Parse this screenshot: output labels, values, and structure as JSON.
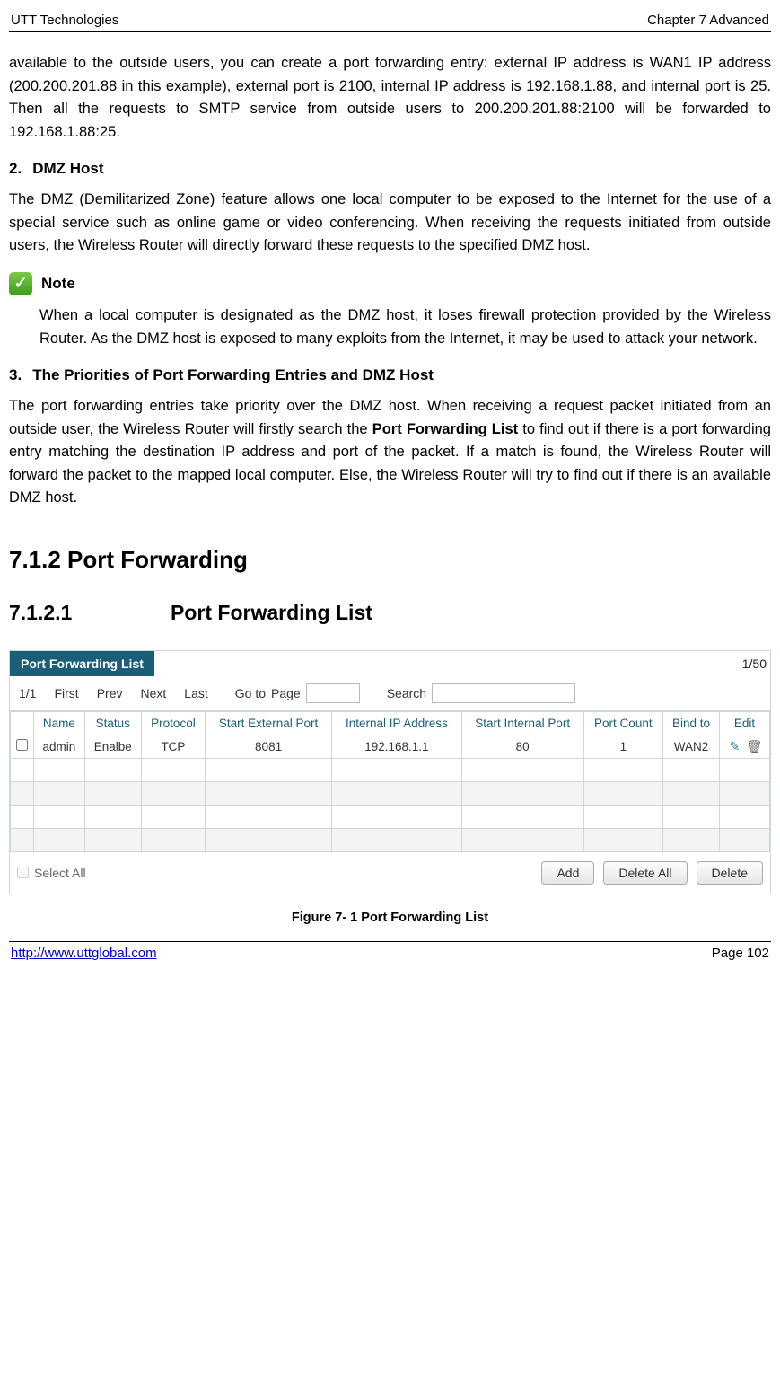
{
  "header": {
    "left": "UTT Technologies",
    "right": "Chapter 7 Advanced"
  },
  "para1": "available to the outside users, you can create a port forwarding entry: external IP address is WAN1 IP address (200.200.201.88 in this example), external port is 2100, internal IP address is 192.168.1.88, and internal port is 25. Then all the requests to SMTP service from outside users to 200.200.201.88:2100 will be forwarded to 192.168.1.88:25.",
  "section2": {
    "num": "2.",
    "title": "DMZ Host"
  },
  "para2": "The DMZ (Demilitarized Zone) feature allows one local computer to be exposed to the Internet for the use of a special service such as online game or video conferencing. When receiving the requests initiated from outside users, the Wireless Router will directly forward these requests to the specified DMZ host.",
  "note": {
    "label": "Note",
    "body": "When a local computer is designated as the DMZ host, it loses firewall protection provided by the Wireless Router. As the DMZ host is exposed to many exploits from the Internet, it may be used to attack your network."
  },
  "section3": {
    "num": "3.",
    "title": "The Priorities of Port Forwarding Entries and DMZ Host"
  },
  "para3_pre": "The port forwarding entries take priority over the DMZ host. When receiving a request packet initiated from an outside user, the Wireless Router will firstly search the ",
  "para3_bold": "Port Forwarding List",
  "para3_post": " to find out if there is a port forwarding entry matching the destination IP address and port of the packet. If a match is found, the Wireless Router will forward the packet to the mapped local computer. Else, the Wireless Router will try to find out if there is an available DMZ host.",
  "h2": "7.1.2    Port Forwarding",
  "h3_num": "7.1.2.1",
  "h3_title": "Port Forwarding List",
  "pf": {
    "tab": "Port Forwarding List",
    "count": "1/50",
    "toolbar": {
      "pageInfo": "1/1",
      "first": "First",
      "prev": "Prev",
      "next": "Next",
      "last": "Last",
      "goto": "Go to",
      "page": "Page",
      "search": "Search"
    },
    "columns": [
      "Name",
      "Status",
      "Protocol",
      "Start External Port",
      "Internal IP Address",
      "Start Internal Port",
      "Port Count",
      "Bind to",
      "Edit"
    ],
    "row1": {
      "name": "admin",
      "status": "Enalbe",
      "protocol": "TCP",
      "extPort": "8081",
      "intIp": "192.168.1.1",
      "intPort": "80",
      "count": "1",
      "bind": "WAN2"
    },
    "footer": {
      "selectAll": "Select All",
      "add": "Add",
      "deleteAll": "Delete All",
      "delete": "Delete"
    }
  },
  "figureCaption": "Figure 7- 1 Port Forwarding List",
  "footer": {
    "url": "http://www.uttglobal.com",
    "pageNum": "Page 102"
  }
}
